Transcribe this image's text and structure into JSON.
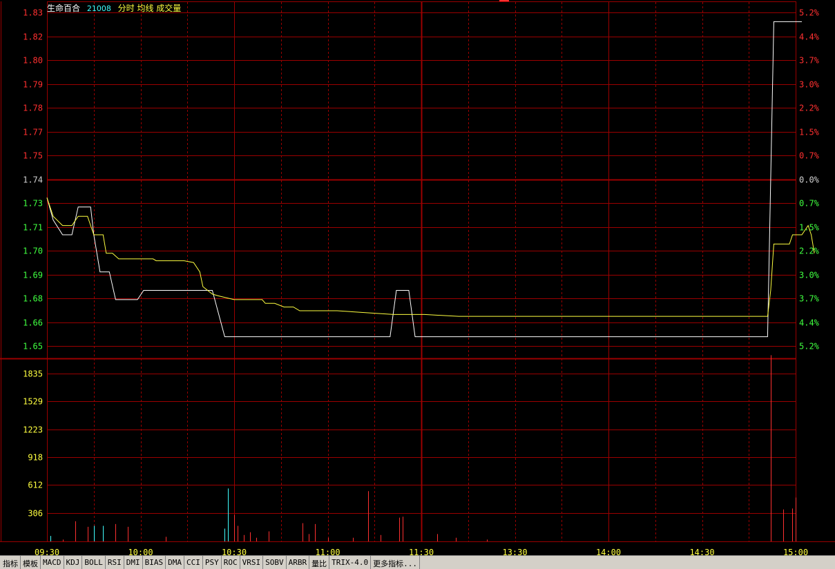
{
  "header": {
    "stock_name": "生命百合",
    "stock_code": "21008",
    "indicators": "分时 均线 成交量"
  },
  "tabs": [
    "指标",
    "模板",
    "MACD",
    "KDJ",
    "BOLL",
    "RSI",
    "DMI",
    "BIAS",
    "DMA",
    "CCI",
    "PSY",
    "ROC",
    "VRSI",
    "SOBV",
    "ARBR",
    "量比",
    "TRIX-4.0",
    "更多指标..."
  ],
  "colors": {
    "background": "#000000",
    "grid": "#9c0000",
    "price_line": "#ffffff",
    "avg_line": "#ffff40",
    "up": "#ff3030",
    "down": "#40ff40",
    "neutral": "#d0d0d0",
    "volume_axis": "#ffff40",
    "volume_up": "#ff3030",
    "volume_down": "#40ffff"
  },
  "chart_data": {
    "type": "line",
    "title": "",
    "prev_close": 1.74,
    "price_ticks": [
      "1.83",
      "1.82",
      "1.80",
      "1.79",
      "1.78",
      "1.77",
      "1.75",
      "1.74",
      "1.73",
      "1.71",
      "1.70",
      "1.69",
      "1.68",
      "1.66",
      "1.65"
    ],
    "pct_ticks": [
      "5.2%",
      "4.4%",
      "3.7%",
      "3.0%",
      "2.2%",
      "1.5%",
      "0.7%",
      "0.0%",
      "0.7%",
      "1.5%",
      "2.2%",
      "3.0%",
      "3.7%",
      "4.4%",
      "5.2%"
    ],
    "volume_ticks": [
      "1835",
      "1529",
      "1223",
      "918",
      "612",
      "306"
    ],
    "time_ticks": [
      "09:30",
      "10:00",
      "10:30",
      "11:00",
      "11:30",
      "13:30",
      "14:00",
      "14:30",
      "15:00"
    ],
    "ylim": [
      1.65,
      1.83
    ],
    "volume_max": 2141,
    "x_minutes_range": [
      0,
      240
    ],
    "series": [
      {
        "name": "分时",
        "points": [
          [
            0,
            1.73
          ],
          [
            2,
            1.718
          ],
          [
            5,
            1.71
          ],
          [
            8,
            1.71
          ],
          [
            10,
            1.725
          ],
          [
            14,
            1.725
          ],
          [
            15,
            1.71
          ],
          [
            17,
            1.69
          ],
          [
            20,
            1.69
          ],
          [
            22,
            1.675
          ],
          [
            29,
            1.675
          ],
          [
            31,
            1.68
          ],
          [
            47,
            1.68
          ],
          [
            53,
            1.68
          ],
          [
            57,
            1.655
          ],
          [
            110,
            1.655
          ],
          [
            112,
            1.68
          ],
          [
            116,
            1.68
          ],
          [
            118,
            1.655
          ],
          [
            231,
            1.655
          ],
          [
            233,
            1.825
          ],
          [
            242,
            1.825
          ]
        ]
      },
      {
        "name": "均线",
        "points": [
          [
            0,
            1.73
          ],
          [
            2,
            1.72
          ],
          [
            5,
            1.715
          ],
          [
            8,
            1.715
          ],
          [
            10,
            1.72
          ],
          [
            11,
            1.72
          ],
          [
            13,
            1.72
          ],
          [
            15,
            1.71
          ],
          [
            18,
            1.71
          ],
          [
            19,
            1.7
          ],
          [
            21,
            1.7
          ],
          [
            23,
            1.697
          ],
          [
            34,
            1.697
          ],
          [
            35,
            1.696
          ],
          [
            44,
            1.696
          ],
          [
            47,
            1.695
          ],
          [
            49,
            1.69
          ],
          [
            50,
            1.682
          ],
          [
            53,
            1.678
          ],
          [
            55,
            1.677
          ],
          [
            60,
            1.675
          ],
          [
            69,
            1.675
          ],
          [
            70,
            1.673
          ],
          [
            73,
            1.673
          ],
          [
            76,
            1.671
          ],
          [
            79,
            1.671
          ],
          [
            81,
            1.669
          ],
          [
            93,
            1.669
          ],
          [
            111,
            1.667
          ],
          [
            121,
            1.667
          ],
          [
            132,
            1.666
          ],
          [
            157,
            1.666
          ],
          [
            231,
            1.666
          ],
          [
            232,
            1.68
          ],
          [
            233,
            1.705
          ],
          [
            234,
            1.705
          ],
          [
            238,
            1.705
          ],
          [
            239,
            1.71
          ],
          [
            242,
            1.71
          ],
          [
            244,
            1.715
          ],
          [
            245,
            1.71
          ],
          [
            246,
            1.7
          ]
        ]
      }
    ],
    "volume": [
      {
        "t": 1,
        "v": 60,
        "up": false
      },
      {
        "t": 5,
        "v": 20,
        "up": true
      },
      {
        "t": 9,
        "v": 220,
        "up": true
      },
      {
        "t": 13,
        "v": 160,
        "up": true
      },
      {
        "t": 15,
        "v": 170,
        "up": false
      },
      {
        "t": 18,
        "v": 170,
        "up": false
      },
      {
        "t": 22,
        "v": 190,
        "up": true
      },
      {
        "t": 26,
        "v": 160,
        "up": true
      },
      {
        "t": 38,
        "v": 50,
        "up": true
      },
      {
        "t": 57,
        "v": 140,
        "up": false
      },
      {
        "t": 58,
        "v": 580,
        "up": false
      },
      {
        "t": 60,
        "v": 290,
        "up": true
      },
      {
        "t": 61,
        "v": 170,
        "up": true
      },
      {
        "t": 63,
        "v": 70,
        "up": true
      },
      {
        "t": 65,
        "v": 100,
        "up": true
      },
      {
        "t": 67,
        "v": 40,
        "up": true
      },
      {
        "t": 71,
        "v": 110,
        "up": true
      },
      {
        "t": 82,
        "v": 200,
        "up": true
      },
      {
        "t": 84,
        "v": 80,
        "up": true
      },
      {
        "t": 86,
        "v": 190,
        "up": true
      },
      {
        "t": 90,
        "v": 40,
        "up": true
      },
      {
        "t": 98,
        "v": 40,
        "up": true
      },
      {
        "t": 103,
        "v": 550,
        "up": true
      },
      {
        "t": 107,
        "v": 70,
        "up": true
      },
      {
        "t": 113,
        "v": 260,
        "up": true
      },
      {
        "t": 114,
        "v": 270,
        "up": true
      },
      {
        "t": 125,
        "v": 80,
        "up": true
      },
      {
        "t": 131,
        "v": 40,
        "up": true
      },
      {
        "t": 141,
        "v": 20,
        "up": true
      },
      {
        "t": 232,
        "v": 2040,
        "up": true
      },
      {
        "t": 236,
        "v": 350,
        "up": true
      },
      {
        "t": 239,
        "v": 360,
        "up": true
      },
      {
        "t": 240,
        "v": 480,
        "up": true
      }
    ]
  }
}
